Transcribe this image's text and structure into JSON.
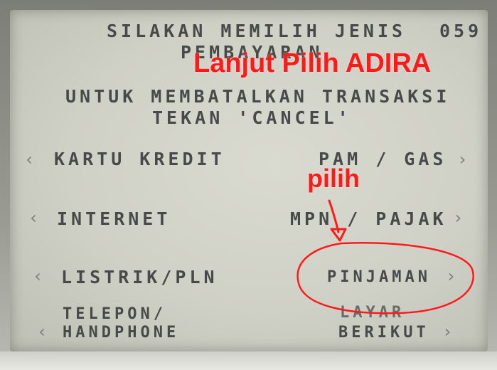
{
  "header": {
    "line1": "SILAKAN MEMILIH JENIS",
    "screen_code": "059",
    "line2": "PEMBAYARAN"
  },
  "instruction": {
    "line1": "UNTUK MEMBATALKAN TRANSAKSI",
    "line2": "TEKAN 'CANCEL'"
  },
  "left_options": [
    {
      "label": "KARTU KREDIT"
    },
    {
      "label": "INTERNET"
    },
    {
      "label": "LISTRIK/PLN"
    },
    {
      "label_line1": "TELEPON/",
      "label_line2": "HANDPHONE"
    }
  ],
  "right_options": [
    {
      "label": "PAM / GAS"
    },
    {
      "label": "MPN / PAJAK"
    },
    {
      "label": "PINJAMAN"
    },
    {
      "label_line1": "LAYAR",
      "label_line2": "BERIKUT"
    }
  ],
  "annotations": {
    "title": "Lanjut Pilih ADIRA",
    "pointer_text": "pilih",
    "color": "#ff1a1a"
  }
}
